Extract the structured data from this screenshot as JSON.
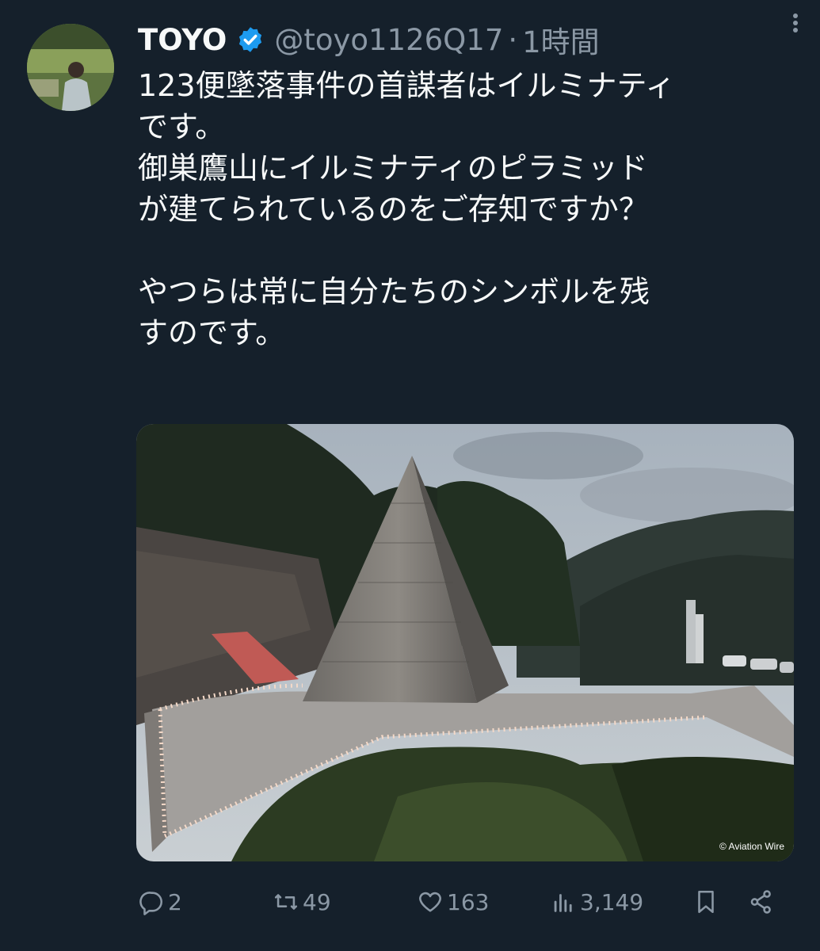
{
  "tweet": {
    "author_name": "TOYO",
    "handle": "@toyo1126Q17",
    "separator": "·",
    "time": "1時間",
    "lines": [
      "123便墜落事件の首謀者はイルミナティ",
      "です。",
      "御巣鷹山にイルミナティのピラミッド",
      "が建てられているのをご存知ですか？",
      "",
      "やつらは常に自分たちのシンボルを残",
      "すのです。"
    ],
    "image_credit": "© Aviation Wire"
  },
  "actions": {
    "replies": "2",
    "retweets": "49",
    "likes": "163",
    "views": "3,149"
  },
  "icons": {
    "verified": "verified-badge-icon",
    "more": "more-options-icon",
    "reply": "reply-icon",
    "retweet": "retweet-icon",
    "like": "heart-icon",
    "views": "views-icon",
    "bookmark": "bookmark-icon",
    "share": "share-icon"
  },
  "colors": {
    "background": "#15202b",
    "text": "#f7f9f9",
    "muted": "#8b98a5",
    "verified": "#1d9bf0"
  }
}
